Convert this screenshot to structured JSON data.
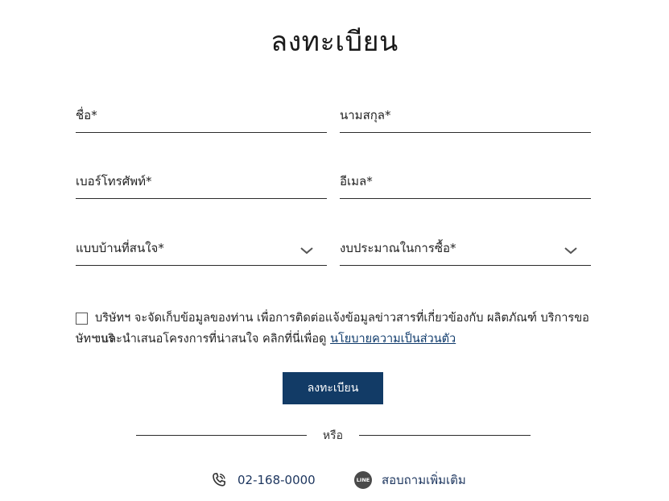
{
  "form": {
    "title": "ลงทะเบียน",
    "fields": {
      "first_name": "ชื่อ*",
      "last_name": "นามสกุล*",
      "phone": "เบอร์โทรศัพท์*",
      "email": "อีเมล*",
      "house_type": "แบบบ้านที่สนใจ*",
      "budget": "งบประมาณในการซื้อ*"
    },
    "consent": {
      "line1": "บริษัทฯ จะจัดเก็บข้อมูลของท่าน เพื่อการติดต่อแจ้งข้อมูลข่าวสารที่เกี่ยวข้องกับ ผลิตภัณฑ์ บริการของบริ",
      "line2_prefix": "ษัทฯ และนำเสนอโครงการที่น่าสนใจ คลิกที่นี่เพื่อดู",
      "privacy_link": "นโยบายความเป็นส่วนตัว",
      "checked": false
    },
    "submit_label": "ลงทะเบียน",
    "or_label": "หรือ"
  },
  "contact": {
    "phone_number": "02-168-0000",
    "line_badge": "LINE",
    "line_label": "สอบถามเพิ่มเติม"
  },
  "colors": {
    "primary": "#123b66",
    "link": "#0e3a6b",
    "contact_text": "#1c355e"
  },
  "icons": {
    "select_arrow": "chevron-down-icon",
    "phone": "phone-icon",
    "line": "line-icon"
  }
}
